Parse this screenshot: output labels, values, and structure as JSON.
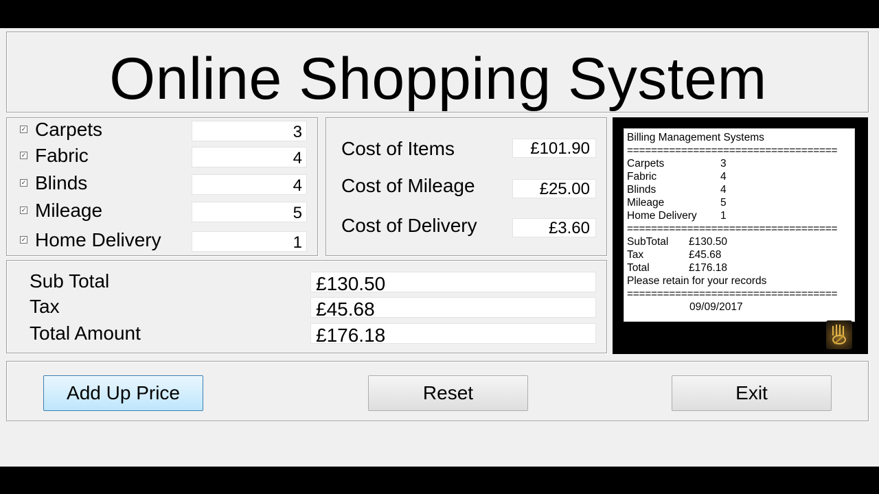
{
  "app": {
    "title": "Online Shopping System"
  },
  "items": [
    {
      "label": "Carpets",
      "checked": true,
      "qty": "3"
    },
    {
      "label": "Fabric",
      "checked": true,
      "qty": "4"
    },
    {
      "label": "Blinds",
      "checked": true,
      "qty": "4"
    },
    {
      "label": "Mileage",
      "checked": true,
      "qty": "5"
    },
    {
      "label": "Home Delivery",
      "checked": true,
      "qty": "1"
    }
  ],
  "costs": [
    {
      "label": "Cost of Items",
      "value": "£101.90"
    },
    {
      "label": "Cost of Mileage",
      "value": "£25.00"
    },
    {
      "label": "Cost of Delivery",
      "value": "£3.60"
    }
  ],
  "totals": [
    {
      "label": "Sub Total",
      "value": "£130.50"
    },
    {
      "label": "Tax",
      "value": "£45.68"
    },
    {
      "label": "Total Amount",
      "value": "£176.18"
    }
  ],
  "receipt": {
    "heading": "Billing Management Systems",
    "separator": "===================================",
    "items": [
      {
        "name": "Carpets",
        "qty": "3"
      },
      {
        "name": "Fabric",
        "qty": "4"
      },
      {
        "name": "Blinds",
        "qty": "4"
      },
      {
        "name": "Mileage",
        "qty": "5"
      },
      {
        "name": "Home Delivery",
        "qty": "1"
      }
    ],
    "totals": [
      {
        "name": "SubTotal",
        "value": "£130.50"
      },
      {
        "name": "Tax",
        "value": "£45.68"
      },
      {
        "name": "Total",
        "value": "£176.18"
      }
    ],
    "note": "Please retain for your records",
    "date": "09/09/2017"
  },
  "buttons": {
    "add_up_price": "Add Up Price",
    "reset": "Reset",
    "exit": "Exit"
  },
  "colors": {
    "form_bg": "#f0f0f0",
    "primary_button": "#bee6fd",
    "receipt_panel": "#000000"
  }
}
